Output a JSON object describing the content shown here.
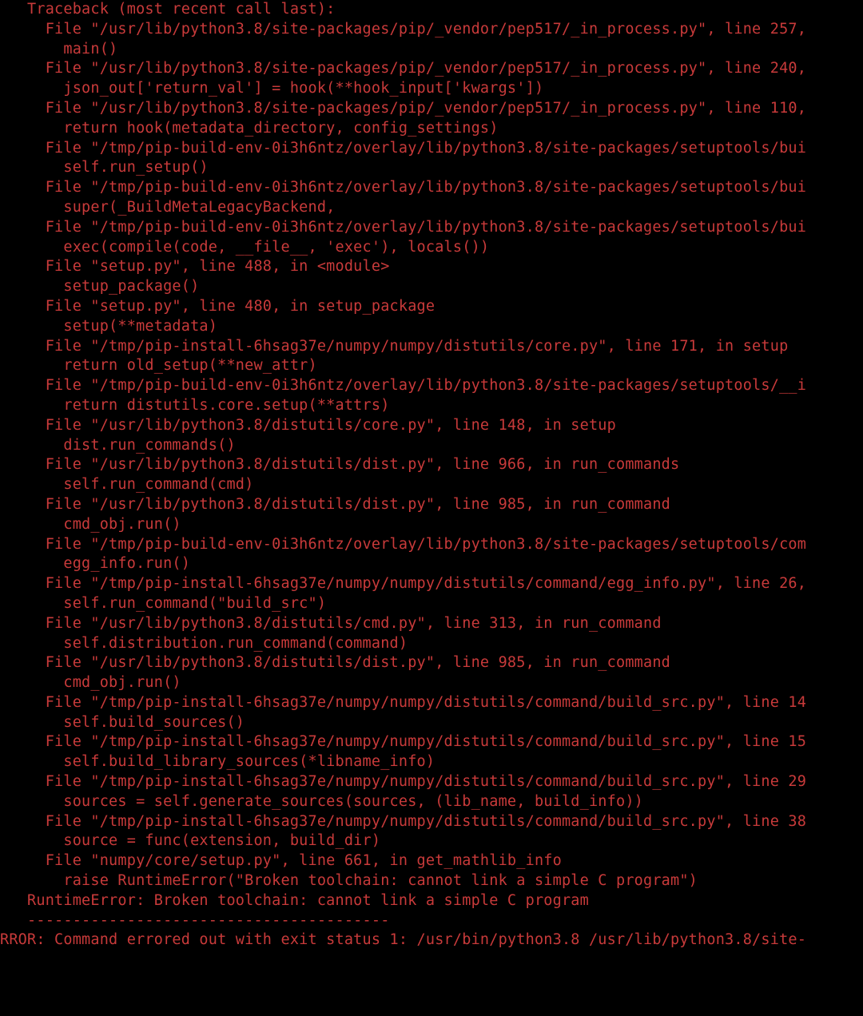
{
  "traceback": {
    "header": "   Traceback (most recent call last):",
    "frames": [
      {
        "loc": "     File \"/usr/lib/python3.8/site-packages/pip/_vendor/pep517/_in_process.py\", line 257,",
        "code": "       main()"
      },
      {
        "loc": "     File \"/usr/lib/python3.8/site-packages/pip/_vendor/pep517/_in_process.py\", line 240,",
        "code": "       json_out['return_val'] = hook(**hook_input['kwargs'])"
      },
      {
        "loc": "     File \"/usr/lib/python3.8/site-packages/pip/_vendor/pep517/_in_process.py\", line 110,",
        "code": "       return hook(metadata_directory, config_settings)"
      },
      {
        "loc": "     File \"/tmp/pip-build-env-0i3h6ntz/overlay/lib/python3.8/site-packages/setuptools/bui",
        "code": "       self.run_setup()"
      },
      {
        "loc": "     File \"/tmp/pip-build-env-0i3h6ntz/overlay/lib/python3.8/site-packages/setuptools/bui",
        "code": "       super(_BuildMetaLegacyBackend,"
      },
      {
        "loc": "     File \"/tmp/pip-build-env-0i3h6ntz/overlay/lib/python3.8/site-packages/setuptools/bui",
        "code": "       exec(compile(code, __file__, 'exec'), locals())"
      },
      {
        "loc": "     File \"setup.py\", line 488, in <module>",
        "code": "       setup_package()"
      },
      {
        "loc": "     File \"setup.py\", line 480, in setup_package",
        "code": "       setup(**metadata)"
      },
      {
        "loc": "     File \"/tmp/pip-install-6hsag37e/numpy/numpy/distutils/core.py\", line 171, in setup",
        "code": "       return old_setup(**new_attr)"
      },
      {
        "loc": "     File \"/tmp/pip-build-env-0i3h6ntz/overlay/lib/python3.8/site-packages/setuptools/__i",
        "code": "       return distutils.core.setup(**attrs)"
      },
      {
        "loc": "     File \"/usr/lib/python3.8/distutils/core.py\", line 148, in setup",
        "code": "       dist.run_commands()"
      },
      {
        "loc": "     File \"/usr/lib/python3.8/distutils/dist.py\", line 966, in run_commands",
        "code": "       self.run_command(cmd)"
      },
      {
        "loc": "     File \"/usr/lib/python3.8/distutils/dist.py\", line 985, in run_command",
        "code": "       cmd_obj.run()"
      },
      {
        "loc": "     File \"/tmp/pip-build-env-0i3h6ntz/overlay/lib/python3.8/site-packages/setuptools/com",
        "code": "       egg_info.run()"
      },
      {
        "loc": "     File \"/tmp/pip-install-6hsag37e/numpy/numpy/distutils/command/egg_info.py\", line 26,",
        "code": "       self.run_command(\"build_src\")"
      },
      {
        "loc": "     File \"/usr/lib/python3.8/distutils/cmd.py\", line 313, in run_command",
        "code": "       self.distribution.run_command(command)"
      },
      {
        "loc": "     File \"/usr/lib/python3.8/distutils/dist.py\", line 985, in run_command",
        "code": "       cmd_obj.run()"
      },
      {
        "loc": "     File \"/tmp/pip-install-6hsag37e/numpy/numpy/distutils/command/build_src.py\", line 14",
        "code": "       self.build_sources()"
      },
      {
        "loc": "     File \"/tmp/pip-install-6hsag37e/numpy/numpy/distutils/command/build_src.py\", line 15",
        "code": "       self.build_library_sources(*libname_info)"
      },
      {
        "loc": "     File \"/tmp/pip-install-6hsag37e/numpy/numpy/distutils/command/build_src.py\", line 29",
        "code": "       sources = self.generate_sources(sources, (lib_name, build_info))"
      },
      {
        "loc": "     File \"/tmp/pip-install-6hsag37e/numpy/numpy/distutils/command/build_src.py\", line 38",
        "code": "       source = func(extension, build_dir)"
      },
      {
        "loc": "     File \"numpy/core/setup.py\", line 661, in get_mathlib_info",
        "code": "       raise RuntimeError(\"Broken toolchain: cannot link a simple C program\")"
      }
    ],
    "error": "   RuntimeError: Broken toolchain: cannot link a simple C program",
    "sep": "   ----------------------------------------",
    "footer": "RROR: Command errored out with exit status 1: /usr/bin/python3.8 /usr/lib/python3.8/site-"
  }
}
